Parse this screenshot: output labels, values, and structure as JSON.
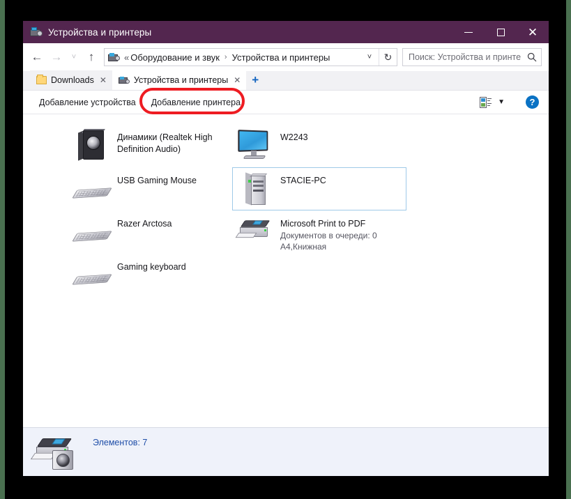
{
  "window": {
    "title": "Устройства и принтеры",
    "titlebar_color": "#53264f",
    "minimize_label": "Свернуть",
    "maximize_label": "Развернуть",
    "close_label": "Закрыть"
  },
  "navbar": {
    "back_glyph": "←",
    "forward_glyph": "→",
    "recent_glyph": "˅",
    "up_glyph": "↑",
    "breadcrumb_lead": "«",
    "breadcrumbs": [
      {
        "label": "Оборудование и звук"
      },
      {
        "label": "Устройства и принтеры"
      }
    ],
    "separator": "›",
    "dropdown_glyph": "˅",
    "refresh_glyph": "↻",
    "search_placeholder": "Поиск: Устройства и принте",
    "search_value": "",
    "search_glyph": "⌕"
  },
  "tabs": {
    "items": [
      {
        "label": "Downloads",
        "icon": "folder-icon",
        "active": false,
        "close_glyph": "✕"
      },
      {
        "label": "Устройства и принтеры",
        "icon": "devices-printers-icon",
        "active": true,
        "close_glyph": "✕"
      }
    ],
    "new_tab_glyph": "+"
  },
  "toolbar": {
    "add_device_label": "Добавление устройства",
    "add_printer_label": "Добавление принтера",
    "view_options_icon": "view-options-icon",
    "view_caret_glyph": "▼",
    "help_label": "?",
    "highlight_color": "#ee1c22",
    "highlighted_item": "Добавление принтера"
  },
  "content": {
    "left_column": [
      {
        "name": "Динамики (Realtek High Definition Audio)",
        "icon": "speaker-icon",
        "sub": "",
        "selected": false
      },
      {
        "name": "USB Gaming Mouse",
        "icon": "keyboard-icon",
        "sub": "",
        "selected": false
      },
      {
        "name": "Razer Arctosa",
        "icon": "keyboard-icon",
        "sub": "",
        "selected": false
      },
      {
        "name": "Gaming keyboard",
        "icon": "keyboard-icon",
        "sub": "",
        "selected": false
      }
    ],
    "right_column": [
      {
        "name": "W2243",
        "icon": "monitor-icon",
        "sub": "",
        "selected": false
      },
      {
        "name": "STACIE-PC",
        "icon": "pc-tower-icon",
        "sub": "",
        "selected": true
      },
      {
        "name": "Microsoft Print to PDF",
        "icon": "printer-icon",
        "sub_line1": "Документов в очереди: 0",
        "sub_line2": "A4,Книжная",
        "selected": false
      }
    ]
  },
  "statusbar": {
    "icon": "printer-camera-icon",
    "text": "Элементов: 7",
    "text_color": "#1f4ea8"
  }
}
